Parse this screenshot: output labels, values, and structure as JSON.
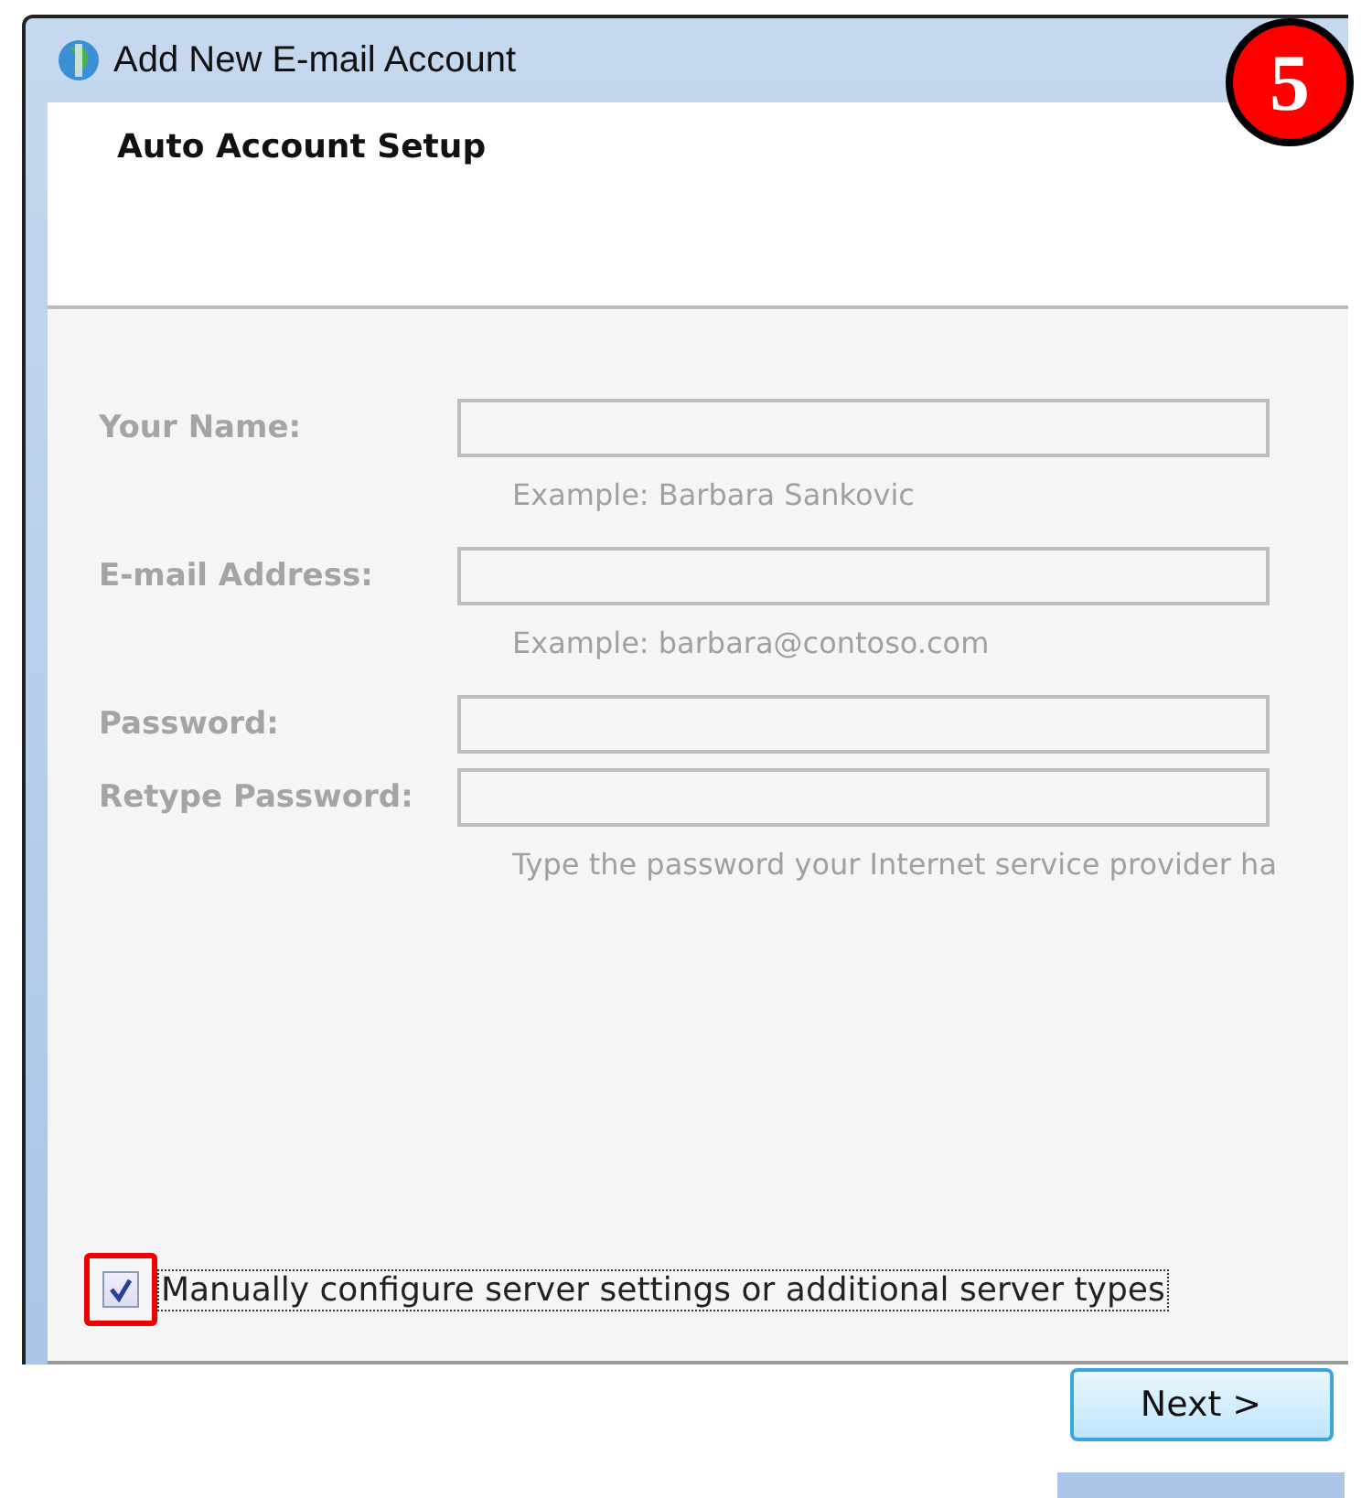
{
  "step_badge": "5",
  "window": {
    "title": "Add New E-mail Account",
    "heading": "Auto Account Setup"
  },
  "fields": [
    {
      "label": "Your Name:",
      "hint": "Example: Barbara Sankovic",
      "disabled": true
    },
    {
      "label": "E-mail Address:",
      "hint": "Example: barbara@contoso.com",
      "disabled": true
    },
    {
      "label": "Password:",
      "disabled": true
    },
    {
      "label": "Retype Password:",
      "hint": "Type the password your Internet service provider ha",
      "disabled": true
    }
  ],
  "manual_setup": {
    "label": "Manually configure server settings or additional server types",
    "checked": true,
    "highlighted": true
  },
  "buttons": [
    {
      "label": "Next >"
    }
  ]
}
